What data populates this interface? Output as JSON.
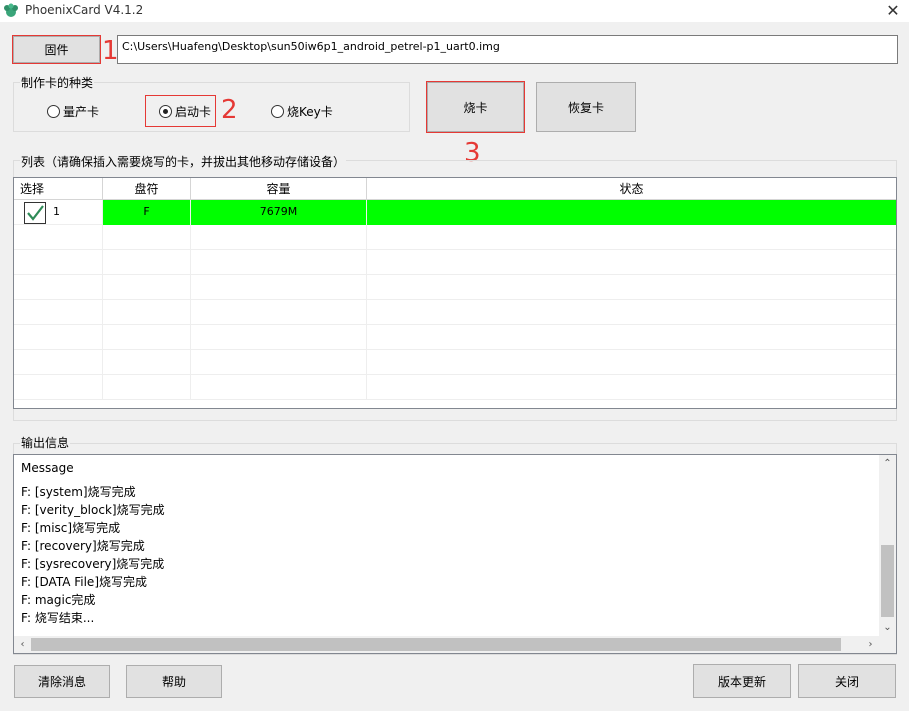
{
  "window": {
    "title": "PhoenixCard V4.1.2",
    "app_icon": "phoenix-icon",
    "close_symbol": "✕"
  },
  "firmware": {
    "button_label": "固件",
    "path_value": "C:\\Users\\Huafeng\\Desktop\\sun50iw6p1_android_petrel-p1_uart0.img"
  },
  "card_type": {
    "group_label": "制作卡的种类",
    "options": [
      {
        "label": "量产卡",
        "selected": false
      },
      {
        "label": "启动卡",
        "selected": true
      },
      {
        "label": "烧Key卡",
        "selected": false
      }
    ]
  },
  "actions": {
    "burn_label": "烧卡",
    "restore_label": "恢复卡"
  },
  "annotations": {
    "n1": "1",
    "n2": "2",
    "n3": "3",
    "color": "#e53935"
  },
  "list": {
    "group_label": "列表（请确保插入需要烧写的卡，并拔出其他移动存储设备）",
    "columns": [
      "选择",
      "盘符",
      "容量",
      "状态"
    ],
    "rows": [
      {
        "index": "1",
        "checked": true,
        "drive": "F",
        "capacity": "7679M",
        "status": "",
        "highlight": "#00ff00"
      }
    ]
  },
  "output": {
    "group_label": "输出信息",
    "lines": [
      "Message",
      "F: [system]烧写完成",
      "F: [verity_block]烧写完成",
      "F: [misc]烧写完成",
      "F: [recovery]烧写完成",
      "F: [sysrecovery]烧写完成",
      "F: [DATA File]烧写完成",
      "F: magic完成",
      "F: 烧写结束..."
    ]
  },
  "bottom": {
    "clear_label": "清除消息",
    "help_label": "帮助",
    "update_label": "版本更新",
    "close_label": "关闭"
  }
}
